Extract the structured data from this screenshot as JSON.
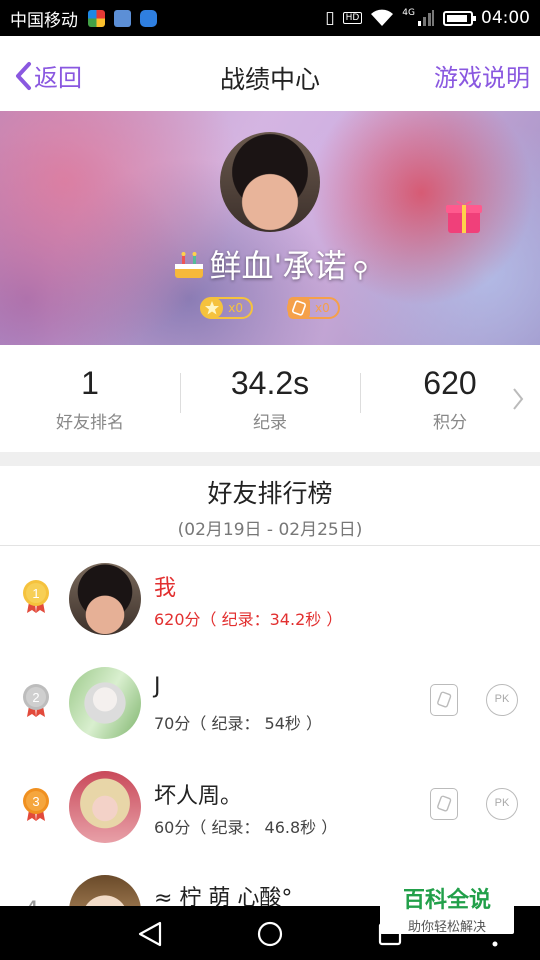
{
  "status_bar": {
    "carrier": "中国移动",
    "time": "04:00",
    "network": "4G",
    "hd": "HD"
  },
  "header": {
    "back_label": "返回",
    "title": "战绩中心",
    "help_label": "游戏说明"
  },
  "profile": {
    "nickname": "鲜血'承诺",
    "badges": [
      {
        "icon": "star-medal-icon",
        "count": "x0"
      },
      {
        "icon": "dice-icon",
        "count": "x0"
      }
    ]
  },
  "stats": [
    {
      "value": "1",
      "label": "好友排名"
    },
    {
      "value": "34.2s",
      "label": "纪录"
    },
    {
      "value": "620",
      "label": "积分"
    }
  ],
  "ranking": {
    "title": "好友排行榜",
    "range": "(02月19日 - 02月25日)",
    "rows": [
      {
        "rank": "1",
        "name": "我",
        "score": "620分（ 纪录：34.2秒 ）"
      },
      {
        "rank": "2",
        "name": "J",
        "score": "70分（ 纪录： 54秒 ）"
      },
      {
        "rank": "3",
        "name": "坏人周。",
        "score": "60分（ 纪录： 46.8秒 ）"
      },
      {
        "rank": "4",
        "name": "≈ 柠 萌 心酸°",
        "score": ""
      }
    ],
    "pk_label": "PK"
  },
  "watermark": {
    "title": "百科全说",
    "subtitle": "助你轻松解决"
  },
  "colors": {
    "accent": "#8a58e0",
    "me_highlight": "#e23030",
    "gold": "#f5c23d",
    "bronze": "#f09020",
    "silver": "#bdbdbd"
  }
}
